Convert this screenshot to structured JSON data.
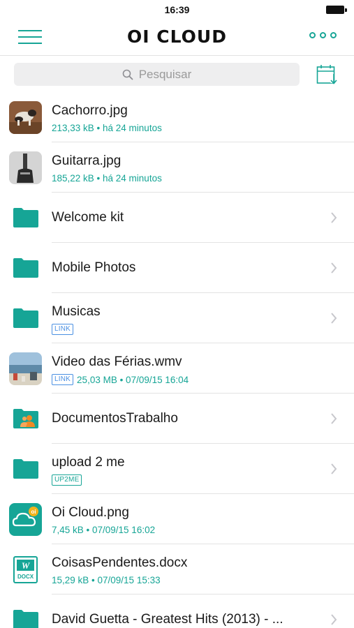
{
  "status_bar": {
    "time": "16:39"
  },
  "header": {
    "title": "OI CLOUD"
  },
  "search": {
    "placeholder": "Pesquisar"
  },
  "files": [
    {
      "name": "Cachorro.jpg",
      "meta": "213,33 kB • há 24 minutos",
      "kind": "image",
      "icon": "dog-photo-thumbnail"
    },
    {
      "name": "Guitarra.jpg",
      "meta": "185,22 kB • há 24 minutos",
      "kind": "image",
      "icon": "guitar-photo-thumbnail"
    },
    {
      "name": "Welcome kit",
      "kind": "folder"
    },
    {
      "name": "Mobile Photos",
      "kind": "folder"
    },
    {
      "name": "Musicas",
      "tag": "LINK",
      "kind": "folder"
    },
    {
      "name": "Video das Férias.wmv",
      "tag": "LINK",
      "meta": "25,03 MB • 07/09/15 16:04",
      "kind": "video",
      "icon": "beach-video-thumbnail"
    },
    {
      "name": "DocumentosTrabalho",
      "kind": "shared-folder"
    },
    {
      "name": "upload 2 me",
      "tag": "UP2ME",
      "kind": "folder"
    },
    {
      "name": "Oi Cloud.png",
      "meta": "7,45 kB • 07/09/15 16:02",
      "kind": "image",
      "icon": "oi-cloud-logo-thumbnail"
    },
    {
      "name": "CoisasPendentes.docx",
      "meta": "15,29 kB • 07/09/15 15:33",
      "kind": "docx",
      "icon": "docx-icon",
      "icon_label": "DOCX"
    },
    {
      "name": "David Guetta - Greatest Hits (2013) - ...",
      "kind": "folder"
    }
  ],
  "colors": {
    "accent": "#16a596",
    "tag_blue": "#4a90e2",
    "separator": "#e3e3e3"
  }
}
